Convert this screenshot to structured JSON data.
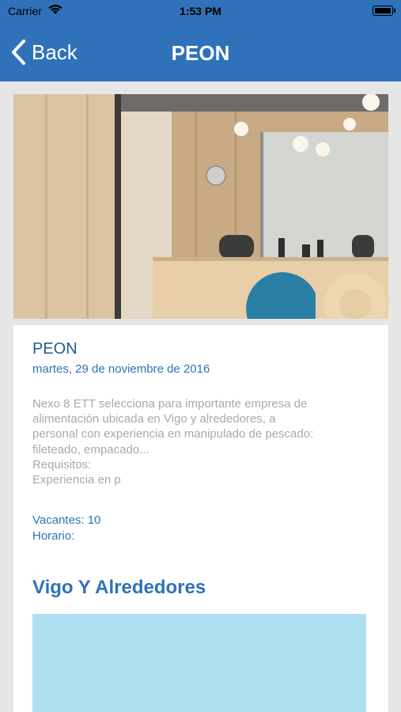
{
  "status_bar": {
    "carrier": "Carrier",
    "time": "1:53 PM"
  },
  "nav": {
    "back_label": "Back",
    "title": "PEON"
  },
  "job": {
    "title": "PEON",
    "date": "martes, 29 de noviembre de 2016",
    "description_lines": [
      "Nexo 8 ETT selecciona para importante empresa de",
      "alimentación ubicada en Vigo y alrededores, a",
      "personal con experiencia en manipulado de pescado:",
      "fileteado, empacado...",
      "Requisitos:",
      "Experiencia en p"
    ],
    "vacantes": "Vacantes: 10",
    "horario": "Horario:"
  },
  "location": {
    "title": "Vigo Y Alrededores"
  },
  "colors": {
    "primary": "#2f72b9",
    "map": "#aee0f2",
    "background": "#e6e6e6"
  }
}
